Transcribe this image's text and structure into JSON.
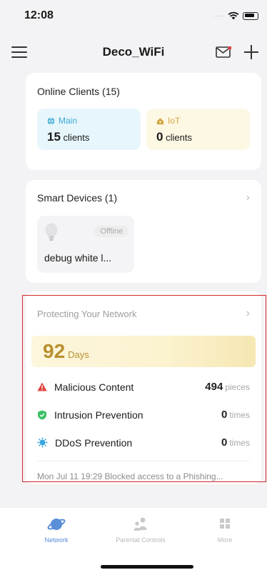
{
  "status": {
    "time": "12:08"
  },
  "nav": {
    "title": "Deco_WiFi",
    "menu_icon": "hamburger-icon",
    "mail_icon": "mail-icon",
    "add_icon": "plus-icon"
  },
  "clients": {
    "title": "Online Clients (15)",
    "main": {
      "label": "Main",
      "count": "15",
      "unit": "clients",
      "color": "#39a9d6"
    },
    "iot": {
      "label": "IoT",
      "count": "0",
      "unit": "clients",
      "color": "#d0a640"
    }
  },
  "devices": {
    "title": "Smart Devices (1)",
    "items": [
      {
        "name": "debug white l...",
        "status": "Offline",
        "icon": "bulb-icon"
      }
    ]
  },
  "protection": {
    "title": "Protecting Your Network",
    "days": "92",
    "days_unit": "Days",
    "stats": [
      {
        "label": "Malicious Content",
        "value": "494",
        "unit": "pieces",
        "icon": "warning-icon",
        "color": "#e2403c"
      },
      {
        "label": "Intrusion Prevention",
        "value": "0",
        "unit": "times",
        "icon": "shield-check-icon",
        "color": "#3bbf64"
      },
      {
        "label": "DDoS Prevention",
        "value": "0",
        "unit": "times",
        "icon": "ddos-icon",
        "color": "#3aa7de"
      }
    ],
    "last_event": "Mon Jul 11 19:29 Blocked access to a Phishing..."
  },
  "tabs": [
    {
      "label": "Network",
      "icon": "network-icon",
      "active": true
    },
    {
      "label": "Parental Controls",
      "icon": "parental-controls-icon",
      "active": false
    },
    {
      "label": "More",
      "icon": "more-icon",
      "active": false
    }
  ]
}
